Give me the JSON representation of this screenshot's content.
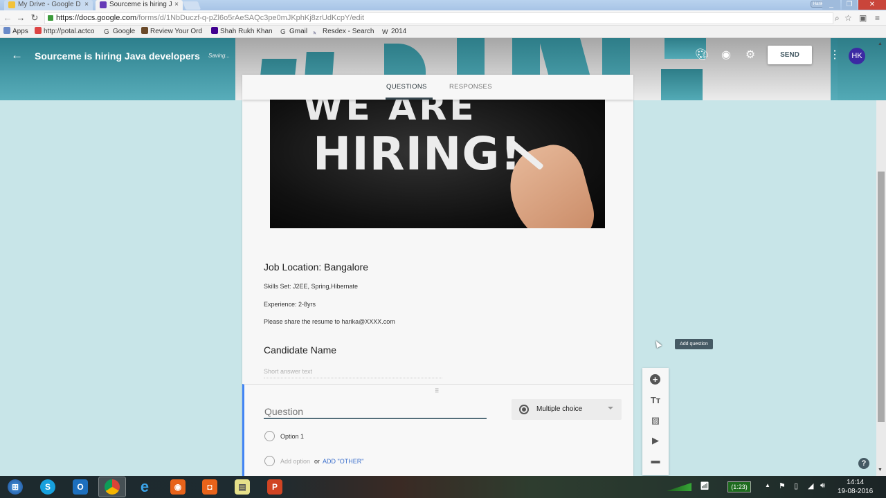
{
  "browser": {
    "tabs": [
      {
        "label": "My Drive - Google D",
        "icon": "google-drive-icon",
        "active": false
      },
      {
        "label": "Sourceme is hiring J",
        "icon": "google-forms-icon",
        "active": true
      }
    ],
    "user_chip": "Harika",
    "url_host": "https://docs.google.com",
    "url_path": "/forms/d/1NbDuczf-q-pZl6o5rAeSAQc3pe0mJKphKj8zrUdKcpY/edit",
    "bookmarks": [
      {
        "label": "Apps",
        "icon": "apps-grid-icon"
      },
      {
        "label": "http://potal.actco",
        "icon": "site-icon"
      },
      {
        "label": "Google",
        "icon": "google-icon"
      },
      {
        "label": "Review Your Ord",
        "icon": "shopping-bag-icon"
      },
      {
        "label": "Shah Rukh Khan",
        "icon": "yahoo-icon"
      },
      {
        "label": "Gmail",
        "icon": "google-icon"
      },
      {
        "label": "Resdex - Search",
        "icon": "resdex-icon"
      },
      {
        "label": "2014",
        "icon": "wikipedia-icon"
      }
    ]
  },
  "header": {
    "title": "Sourceme is hiring Java developers",
    "status": "Saving...",
    "send_label": "SEND",
    "avatar_initials": "HK",
    "icons": [
      "palette-icon",
      "preview-eye-icon",
      "settings-gear-icon",
      "more-vert-icon"
    ],
    "theme_color": "#2e7d88"
  },
  "form": {
    "tabs": [
      {
        "label": "QUESTIONS",
        "active": true
      },
      {
        "label": "RESPONSES",
        "active": false
      }
    ],
    "banner": {
      "line1": "WE ARE",
      "line2": "HIRING!"
    },
    "section_title": "Job Location: Bangalore",
    "description": [
      "Skills Set: J2EE, Spring,Hibernate",
      "Experience: 2-8yrs",
      "Please share the resume to harika@XXXX.com"
    ],
    "questions": [
      {
        "title": "Candidate Name",
        "type": "Short answer",
        "placeholder": "Short answer text"
      }
    ],
    "active_question": {
      "placeholder": "Question",
      "value": "",
      "type_label": "Multiple choice",
      "options": [
        "Option 1"
      ],
      "add_option_label": "Add option",
      "or_label": "or",
      "add_other_label": "ADD \"OTHER\""
    }
  },
  "side_toolbar": {
    "items": [
      "add-question-icon",
      "add-title-icon",
      "add-image-icon",
      "add-video-icon",
      "add-section-icon"
    ],
    "tooltip": "Add question"
  },
  "taskbar": {
    "apps": [
      "windows-start-icon",
      "skype-icon",
      "outlook-icon",
      "chrome-icon",
      "internet-explorer-icon",
      "camera-app-icon",
      "camera-app-2-icon",
      "sticky-notes-icon",
      "powerpoint-icon"
    ],
    "battery_time": "(1:23)",
    "time": "14:14",
    "date": "19-08-2016"
  }
}
